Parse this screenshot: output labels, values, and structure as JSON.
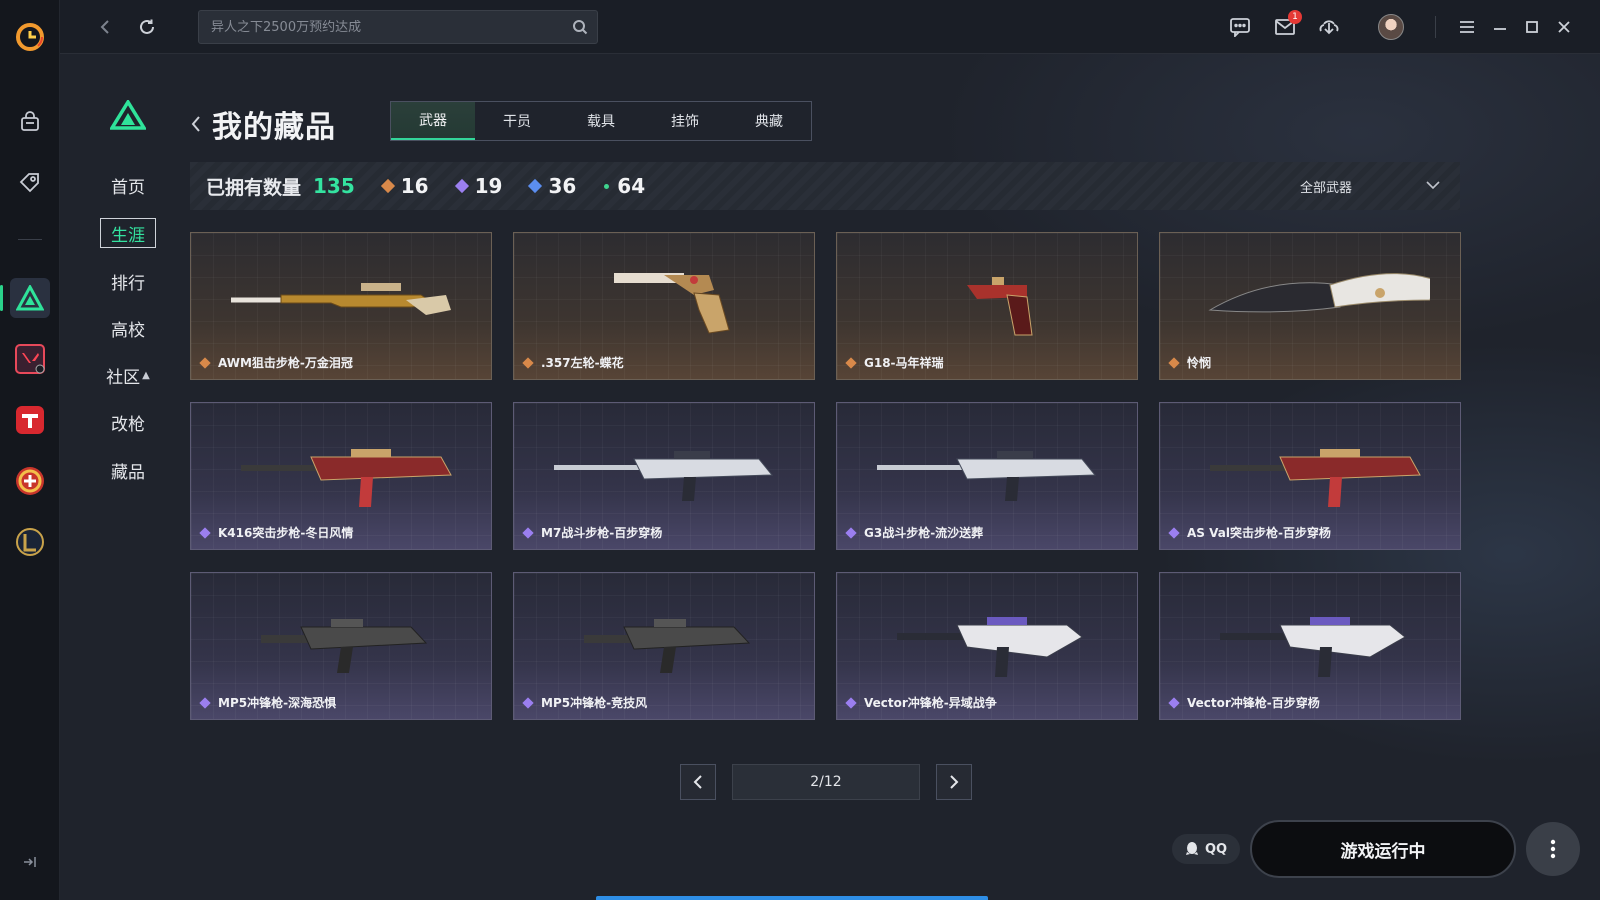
{
  "colors": {
    "accent": "#34e3a0",
    "gold": "#d8894a",
    "purple": "#9b7ff0",
    "blue": "#5b8ef0",
    "green": "#3fd48e",
    "badge": "#e53935"
  },
  "topbar": {
    "search_placeholder": "异人之下2500万预约达成",
    "mail_badge": "1"
  },
  "subnav": {
    "items": [
      {
        "label": "首页"
      },
      {
        "label": "生涯"
      },
      {
        "label": "排行"
      },
      {
        "label": "高校"
      },
      {
        "label": "社区"
      },
      {
        "label": "改枪"
      },
      {
        "label": "藏品"
      }
    ],
    "active_index": 1
  },
  "page": {
    "title": "我的藏品",
    "tabs": [
      "武器",
      "干员",
      "载具",
      "挂饰",
      "典藏"
    ],
    "active_tab": 0
  },
  "stats": {
    "label": "已拥有数量",
    "total": "135",
    "counts": [
      {
        "value": "16",
        "rarity": "gold"
      },
      {
        "value": "19",
        "rarity": "purple"
      },
      {
        "value": "36",
        "rarity": "blue"
      },
      {
        "value": "64",
        "rarity": "green"
      }
    ],
    "filter_label": "全部武器"
  },
  "cards": [
    {
      "name": "AWM狙击步枪-万金泪冠",
      "rarity": "gold",
      "icon": "sniper-rifle-icon"
    },
    {
      "name": ".357左轮-蝶花",
      "rarity": "gold",
      "icon": "revolver-icon"
    },
    {
      "name": "G18-马年祥瑞",
      "rarity": "gold",
      "icon": "pistol-icon"
    },
    {
      "name": "怜悯",
      "rarity": "gold",
      "icon": "knife-icon"
    },
    {
      "name": "K416突击步枪-冬日风情",
      "rarity": "purple",
      "icon": "assault-rifle-icon"
    },
    {
      "name": "M7战斗步枪-百步穿杨",
      "rarity": "purple",
      "icon": "battle-rifle-icon"
    },
    {
      "name": "G3战斗步枪-流沙送葬",
      "rarity": "purple",
      "icon": "battle-rifle-icon"
    },
    {
      "name": "AS Val突击步枪-百步穿杨",
      "rarity": "purple",
      "icon": "assault-rifle-icon"
    },
    {
      "name": "MP5冲锋枪-深海恐惧",
      "rarity": "purple",
      "icon": "smg-icon"
    },
    {
      "name": "MP5冲锋枪-竞技风",
      "rarity": "purple",
      "icon": "smg-icon"
    },
    {
      "name": "Vector冲锋枪-异域战争",
      "rarity": "purple",
      "icon": "vector-smg-icon"
    },
    {
      "name": "Vector冲锋枪-百步穿杨",
      "rarity": "purple",
      "icon": "vector-smg-icon"
    }
  ],
  "pager": {
    "label": "2/12"
  },
  "footer": {
    "qq_label": "QQ",
    "run_label": "游戏运行中"
  }
}
